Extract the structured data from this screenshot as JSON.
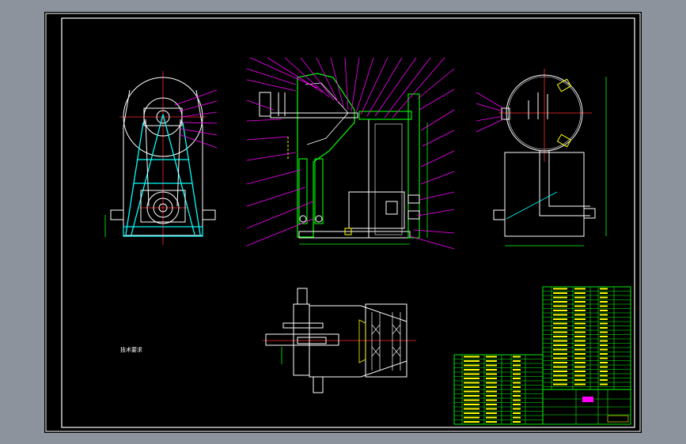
{
  "colors": {
    "frame": "#ffffff",
    "outline": "#ffffff",
    "centerline": "#ff2a2a",
    "leader": "#ff00ff",
    "dimension": "#00ff00",
    "frame_part": "#00ffff",
    "hidden": "#ffff00",
    "table_line": "#00ff00",
    "table_text": "#ffff00",
    "table_accent": "#ff00ff",
    "window_bg": "#8c939d",
    "sheet_bg": "#000000"
  },
  "notes": {
    "heading": "技术要求",
    "lines": []
  },
  "title_block": {
    "drawing_no": ""
  }
}
